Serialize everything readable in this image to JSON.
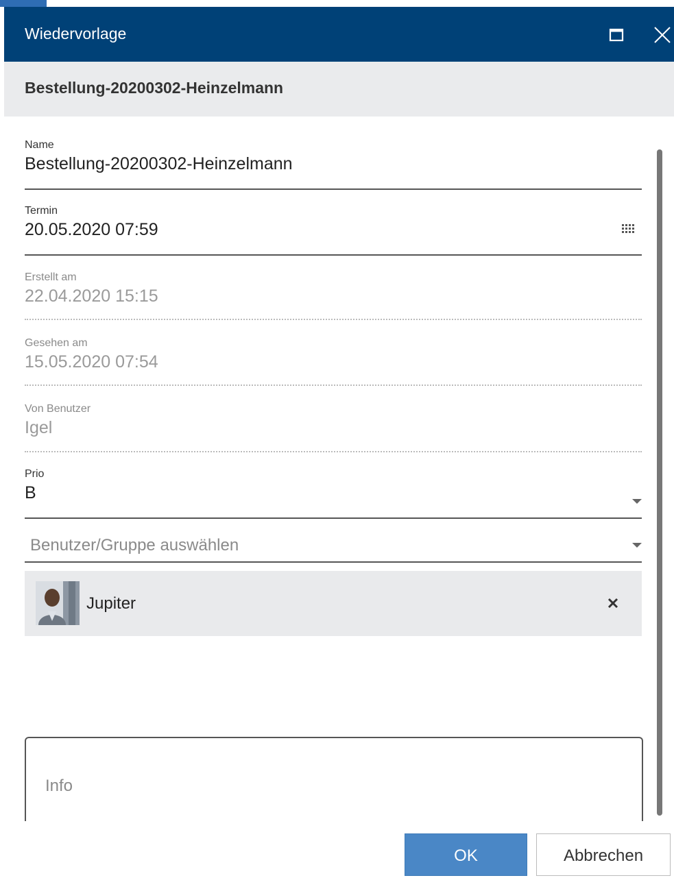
{
  "dialog": {
    "title": "Wiedervorlage",
    "subtitle": "Bestellung-20200302-Heinzelmann"
  },
  "fields": {
    "name": {
      "label": "Name",
      "value": "Bestellung-20200302-Heinzelmann"
    },
    "termin": {
      "label": "Termin",
      "value": "20.05.2020 07:59"
    },
    "erstellt": {
      "label": "Erstellt am",
      "value": "22.04.2020 15:15"
    },
    "gesehen": {
      "label": "Gesehen am",
      "value": "15.05.2020 07:54"
    },
    "von_benutzer": {
      "label": "Von Benutzer",
      "value": "Igel"
    },
    "prio": {
      "label": "Prio",
      "value": "B"
    },
    "user_select": {
      "placeholder": "Benutzer/Gruppe auswählen"
    }
  },
  "selected_users": [
    {
      "name": "Jupiter"
    }
  ],
  "info": {
    "placeholder": "Info"
  },
  "buttons": {
    "ok": "OK",
    "cancel": "Abbrechen"
  },
  "colors": {
    "titlebar": "#004177",
    "primary_button": "#4a87c6",
    "subheader": "#eaebed"
  },
  "icons": [
    "maximize-icon",
    "close-icon",
    "calendar-icon",
    "chevron-down-icon",
    "remove-icon"
  ]
}
